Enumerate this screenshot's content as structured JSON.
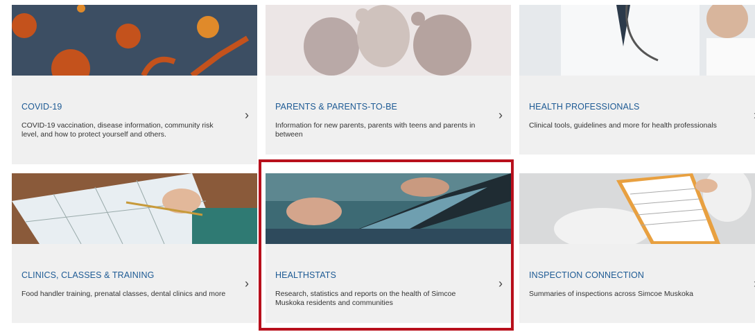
{
  "cards": [
    {
      "title": "COVID-19",
      "description": "COVID-19 vaccination, disease information, community risk level, and how to protect yourself and others.",
      "chevron": "›",
      "image": "covid-virus-image"
    },
    {
      "title": "PARENTS & PARENTS-TO-BE",
      "description": "Information for new parents, parents with teens and parents in between",
      "chevron": "›",
      "image": "teddy-bears-image"
    },
    {
      "title": "HEALTH PROFESSIONALS",
      "description": "Clinical tools, guidelines and more for health professionals",
      "chevron": "›",
      "image": "doctors-image"
    },
    {
      "title": "CLINICS, CLASSES & TRAINING",
      "description": "Food handler training, prenatal classes, dental clinics and more",
      "chevron": "›",
      "image": "calendar-image"
    },
    {
      "title": "HEALTHSTATS",
      "description": "Research, statistics and reports on the health of Simcoe Muskoka residents and communities",
      "chevron": "›",
      "image": "tablet-image"
    },
    {
      "title": "INSPECTION CONNECTION",
      "description": "Summaries of inspections across Simcoe Muskoka",
      "chevron": "›",
      "image": "clipboard-inspection-image"
    }
  ],
  "colors": {
    "title": "#1d5a94",
    "card_bg": "#f0f0f0",
    "highlight": "#b8101c"
  }
}
